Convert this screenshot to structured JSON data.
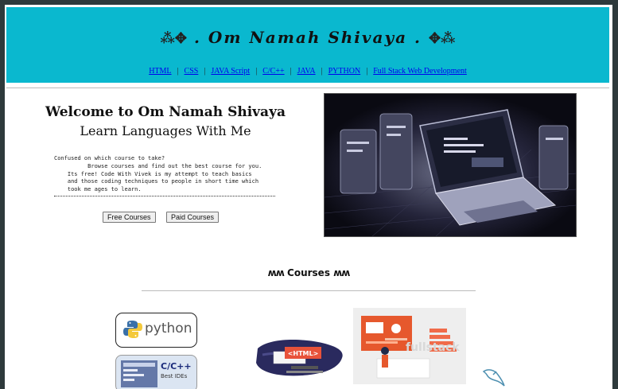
{
  "header": {
    "title": ". Om Namah Shivaya .",
    "ornament_left": "ornament-icon",
    "ornament_right": "ornament-icon",
    "nav": [
      {
        "label": "HTML"
      },
      {
        "label": "CSS"
      },
      {
        "label": "JAVA Script"
      },
      {
        "label": "C/C++"
      },
      {
        "label": "JAVA"
      },
      {
        "label": "PYTHON"
      },
      {
        "label": "Full Stack Web Development"
      }
    ],
    "separator": "|"
  },
  "intro": {
    "heading": "Welcome to Om Namah Shivaya",
    "subheading": "Learn Languages With Me",
    "description": "Confused on which course to take?\n          Browse courses and find out the best course for you.\n    Its free! Code With Vivek is my attempt to teach basics\n    and those coding techniques to people in short time which\n    took me ages to learn.",
    "buttons": {
      "free": "Free Courses",
      "paid": "Paid Courses"
    }
  },
  "hero_image": "laptop-dashboard-illustration",
  "courses": {
    "heading": "Courses",
    "cards": [
      {
        "name": "python",
        "icon": "python-logo"
      },
      {
        "name": "<HTML>",
        "icon": "html-banner"
      },
      {
        "name": "fullstack",
        "icon": "fullstack-illustration"
      },
      {
        "name": "C/C++",
        "sub": "Best IDEs",
        "icon": "cpp-ide-banner"
      },
      {
        "name": "",
        "icon": "mysql-dolphin-icon"
      }
    ]
  },
  "colors": {
    "header_bg": "#0ab8cf",
    "link": "#0000ee",
    "frame": "#2e3a3c"
  }
}
